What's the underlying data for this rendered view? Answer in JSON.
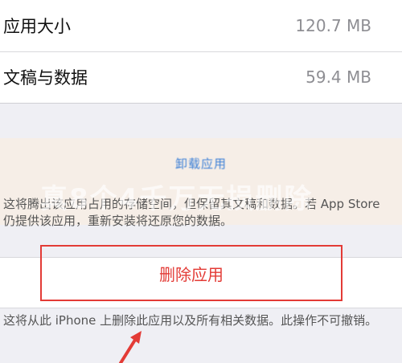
{
  "storage": {
    "app_size_label": "应用大小",
    "app_size_value": "120.7 MB",
    "docs_label": "文稿与数据",
    "docs_value": "59.4 MB"
  },
  "offload": {
    "button_label": "卸载应用",
    "description": "这将腾出该应用占用的存储空间，但保留其文稿和数据。若 App Store 仍提供该应用，重新安装将还原您的数据。"
  },
  "delete": {
    "button_label": "删除应用",
    "description": "这将从此 iPhone 上删除此应用以及所有相关数据。此操作不可撤销。"
  },
  "watermark": "真8个4千万无损删除",
  "colors": {
    "destructive": "#e33b36",
    "link": "#3b7fd6",
    "secondary_text": "#8e8e93",
    "annotation_box": "#e33b36"
  }
}
